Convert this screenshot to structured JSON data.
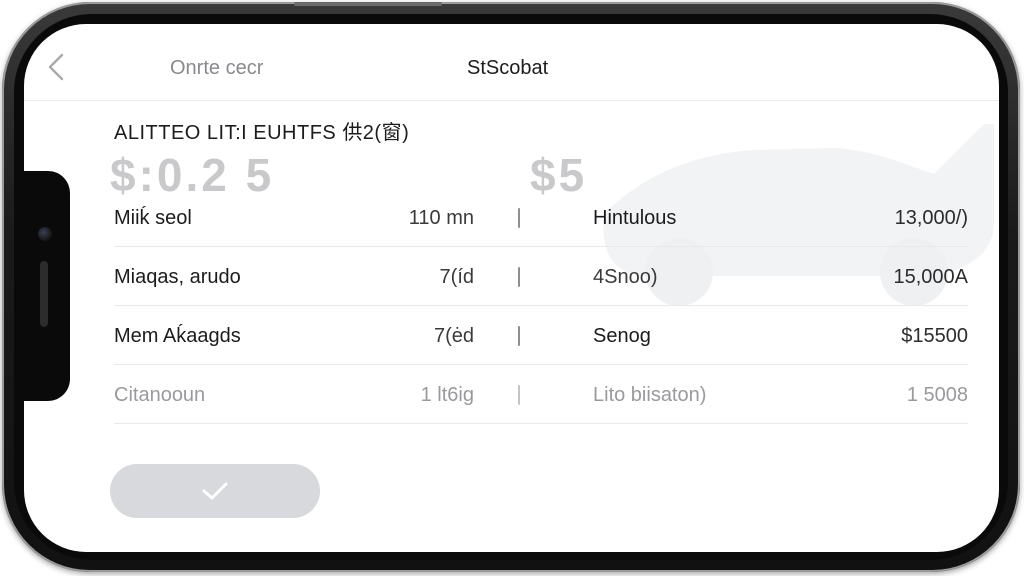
{
  "nav": {
    "back_icon": "chevron-left-icon",
    "left_label": "Onrte cecr",
    "title": "StScobat"
  },
  "summary": {
    "heading": "ALITTEO LIT:I EUHTFS 供2(窗)",
    "price_left": "$:0.2 5",
    "price_right": "$5"
  },
  "table": {
    "rows": [
      {
        "label": "Miiḱ seol",
        "value": "110 mn",
        "label2": "Hintulous",
        "value2": "13,000/)"
      },
      {
        "label": "Miaqas, arudo",
        "value": "7(íd",
        "label2": "4Snoo)",
        "value2": "15,000A"
      },
      {
        "label": "Mem Aḱaagds",
        "value": "7(ėd",
        "label2": "Senog",
        "value2": "$15500"
      },
      {
        "label": "Citanooun",
        "value": "1 lt6ig",
        "label2": "Lito biisaton)",
        "value2": "1 5008"
      }
    ]
  },
  "confirm": {
    "icon": "checkmark-icon"
  },
  "colors": {
    "accent_muted": "#d7d9dc",
    "text_primary": "#1c1c1e",
    "price_muted": "#c9c9cc"
  }
}
